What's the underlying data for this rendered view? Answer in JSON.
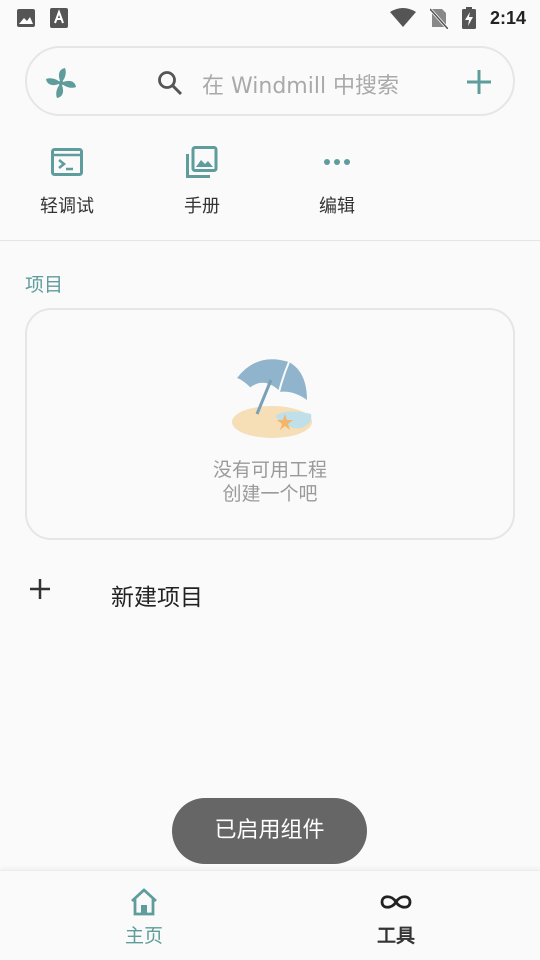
{
  "status_bar": {
    "time": "2:14",
    "left_icons": [
      "image-icon",
      "text-a-icon"
    ],
    "right_icons": [
      "wifi-icon",
      "no-sim-icon",
      "battery-charging-icon"
    ]
  },
  "search": {
    "placeholder": "在 Windmill 中搜索",
    "logo_icon": "windmill-logo-icon",
    "search_icon": "search-icon",
    "add_icon": "plus-icon"
  },
  "quick_actions": [
    {
      "label": "轻调试",
      "icon": "terminal-icon"
    },
    {
      "label": "手册",
      "icon": "gallery-icon"
    },
    {
      "label": "编辑",
      "icon": "more-dots-icon"
    }
  ],
  "projects": {
    "section_title": "项目",
    "empty_line1": "没有可用工程",
    "empty_line2": "创建一个吧",
    "new_label": "新建项目"
  },
  "toast": "已启用组件",
  "bottom_nav": [
    {
      "label": "主页",
      "icon": "home-icon",
      "active": true
    },
    {
      "label": "工具",
      "icon": "infinity-icon",
      "active": false
    }
  ],
  "colors": {
    "accent": "#5f9c9c",
    "background": "#fafafa",
    "toast_bg": "#666666",
    "border": "#e6e6e6"
  }
}
